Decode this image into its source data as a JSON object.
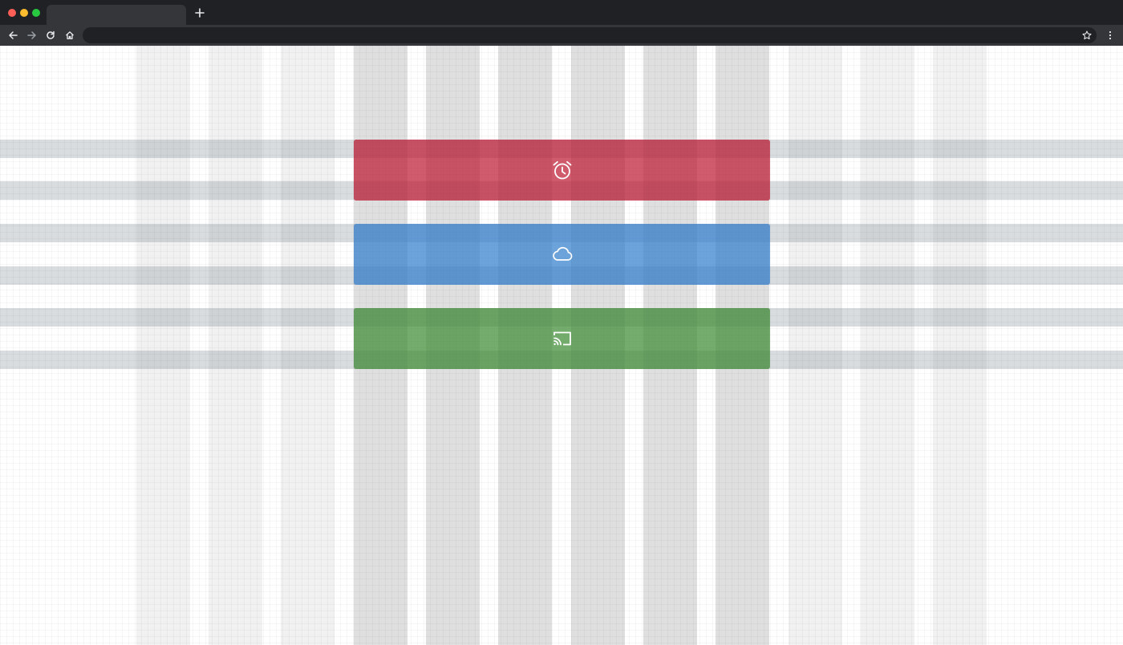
{
  "window": {
    "traffic_lights": [
      "close",
      "minimize",
      "zoom"
    ],
    "tab_title": "",
    "new_tab_icon": "plus-icon"
  },
  "toolbar": {
    "back_icon": "arrow-left-icon",
    "forward_icon": "arrow-right-icon",
    "reload_icon": "reload-icon",
    "home_icon": "home-icon",
    "address_value": "",
    "bookmark_icon": "star-icon",
    "menu_icon": "kebab-menu-icon"
  },
  "cards": [
    {
      "name": "alarm-card",
      "icon": "alarm-clock-icon",
      "color": "#be1c34"
    },
    {
      "name": "cloud-card",
      "icon": "cloud-icon",
      "color": "#3480cd"
    },
    {
      "name": "cast-card",
      "icon": "cast-icon",
      "color": "#3e8c34"
    }
  ],
  "colors": {
    "chrome_dark": "#202124",
    "chrome_mid": "#35363a",
    "grid_column": "#dcdcdc",
    "grid_row": "#d5d9dc"
  }
}
